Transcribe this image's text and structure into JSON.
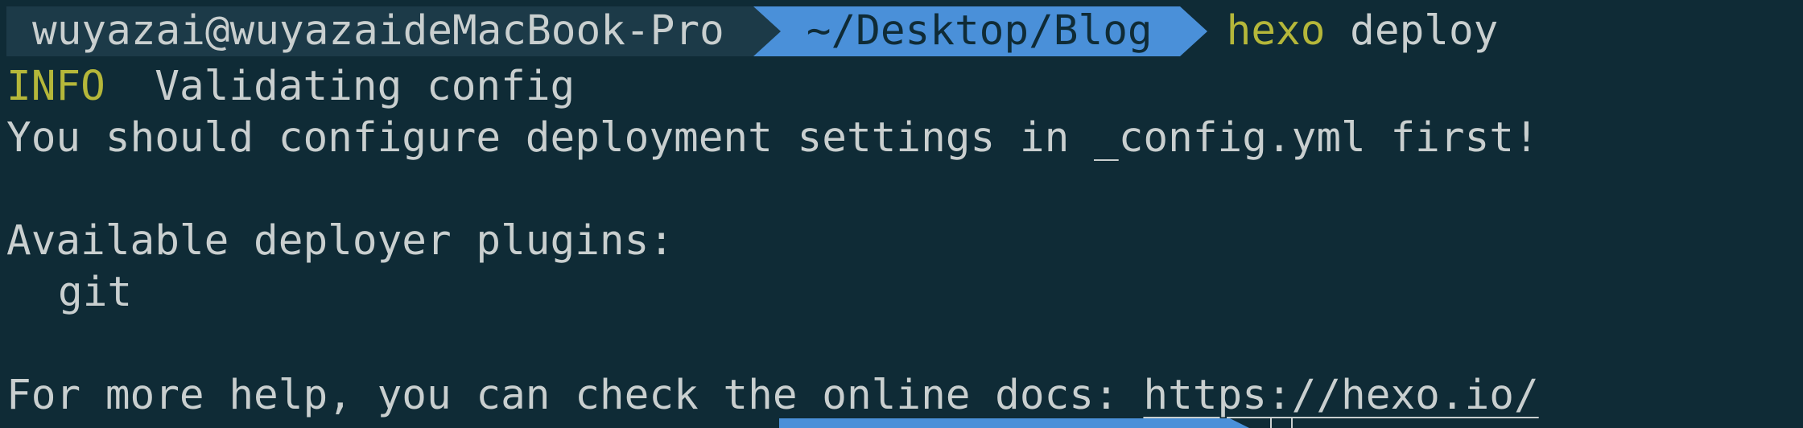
{
  "terminal": {
    "prompt": {
      "user_host": "wuyazai@wuyazaideMacBook-Pro",
      "path": "~/Desktop/Blog",
      "command": "hexo",
      "argument": "deploy"
    },
    "output": {
      "info_tag": "INFO",
      "info_message": "Validating config",
      "warning": "You should configure deployment settings in _config.yml first!",
      "plugins_heading": "Available deployer plugins:",
      "plugin_git": "git",
      "help_prefix": "For more help, you can check the online docs: ",
      "help_link": "https://hexo.io/"
    }
  },
  "colors": {
    "background": "#0f2b36",
    "text": "#c9cfcf",
    "accent_yellow": "#b5b73a",
    "path_segment": "#4a90d9",
    "user_segment": "#1c3a48"
  }
}
